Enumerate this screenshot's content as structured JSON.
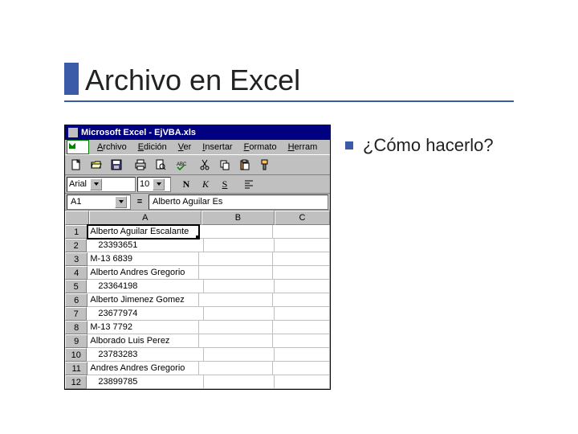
{
  "slide": {
    "title": "Archivo en Excel",
    "bullet_text": "¿Cómo hacerlo?"
  },
  "excel": {
    "titlebar": "Microsoft Excel - EjVBA.xls",
    "menus": [
      "Archivo",
      "Edición",
      "Ver",
      "Insertar",
      "Formato",
      "Herram"
    ],
    "toolbar_icons": [
      "new",
      "open",
      "save",
      "print",
      "preview",
      "spell",
      "cut",
      "copy",
      "paste",
      "fmtpaint"
    ],
    "font_name": "Arial",
    "font_size": "10",
    "style_buttons": {
      "bold": "N",
      "italic": "K",
      "underline": "S"
    },
    "align_icon": "align-left",
    "name_box": "A1",
    "formula_bar": "Alberto Aguilar Es",
    "columns": [
      "A",
      "B",
      "C"
    ],
    "rows": [
      {
        "n": "1",
        "a": "Alberto Aguilar Escalante",
        "b": "",
        "c": ""
      },
      {
        "n": "2",
        "a": "23393651",
        "b": "",
        "c": "",
        "num": true
      },
      {
        "n": "3",
        "a": "M-13 6839",
        "b": "",
        "c": ""
      },
      {
        "n": "4",
        "a": "Alberto Andres Gregorio",
        "b": "",
        "c": ""
      },
      {
        "n": "5",
        "a": "23364198",
        "b": "",
        "c": "",
        "num": true
      },
      {
        "n": "6",
        "a": "Alberto Jimenez Gomez",
        "b": "",
        "c": ""
      },
      {
        "n": "7",
        "a": "23677974",
        "b": "",
        "c": "",
        "num": true
      },
      {
        "n": "8",
        "a": "M-13 7792",
        "b": "",
        "c": ""
      },
      {
        "n": "9",
        "a": "Alborado Luis Perez",
        "b": "",
        "c": ""
      },
      {
        "n": "10",
        "a": "23783283",
        "b": "",
        "c": "",
        "num": true
      },
      {
        "n": "11",
        "a": "Andres Andres Gregorio",
        "b": "",
        "c": ""
      },
      {
        "n": "12",
        "a": "23899785",
        "b": "",
        "c": "",
        "num": true
      }
    ]
  }
}
